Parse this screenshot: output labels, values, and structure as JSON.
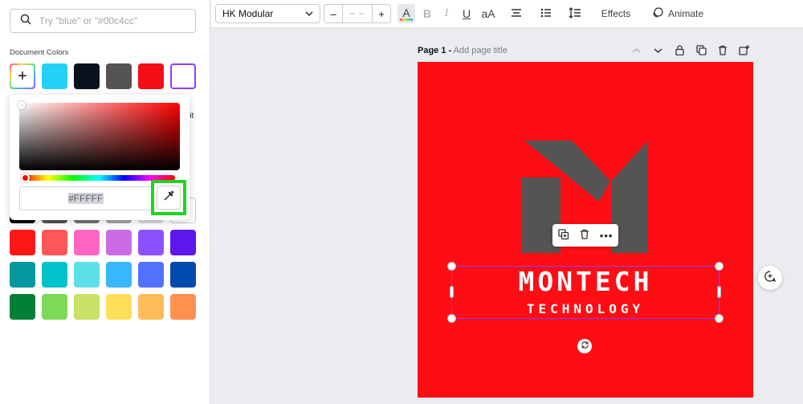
{
  "sidebar": {
    "search_placeholder": "Try \"blue\" or \"#00c4cc\"",
    "document_colors_title": "Document Colors",
    "document_colors": [
      "#23d0f6",
      "#08121c",
      "#545454",
      "#f40e17",
      "#ffffff"
    ],
    "picker": {
      "hex_value": "#FFFFFF",
      "hue_color": "#ff0000"
    },
    "peek_text": "lit",
    "default_colors": [
      [
        "#000000",
        "#545454",
        "#737373",
        "#a6a6a6",
        "#d9d9d9",
        "#ffffff"
      ],
      [
        "#ff1616",
        "#ff5757",
        "#ff66c4",
        "#cb6ce6",
        "#8c52ff",
        "#5e17eb"
      ],
      [
        "#03989e",
        "#00c2cb",
        "#5ce1e6",
        "#38b6ff",
        "#5271ff",
        "#004aad"
      ],
      [
        "#008037",
        "#7ed957",
        "#c9e265",
        "#ffde59",
        "#ffbd59",
        "#ff914d"
      ]
    ]
  },
  "toolbar": {
    "font": "HK Modular",
    "font_size": "– –",
    "minus": "–",
    "plus": "+",
    "text_color_glyph": "A",
    "bold": "B",
    "italic": "I",
    "underline": "U",
    "case": "aA",
    "effects": "Effects",
    "animate": "Animate"
  },
  "page": {
    "label": "Page 1 -",
    "placeholder": "Add page title"
  },
  "canvas": {
    "background": "#ff0d15",
    "title": "MONTECH",
    "subtitle": "TECHNOLOGY",
    "logo_color": "#545454",
    "selection_color": "#8b3dff"
  }
}
